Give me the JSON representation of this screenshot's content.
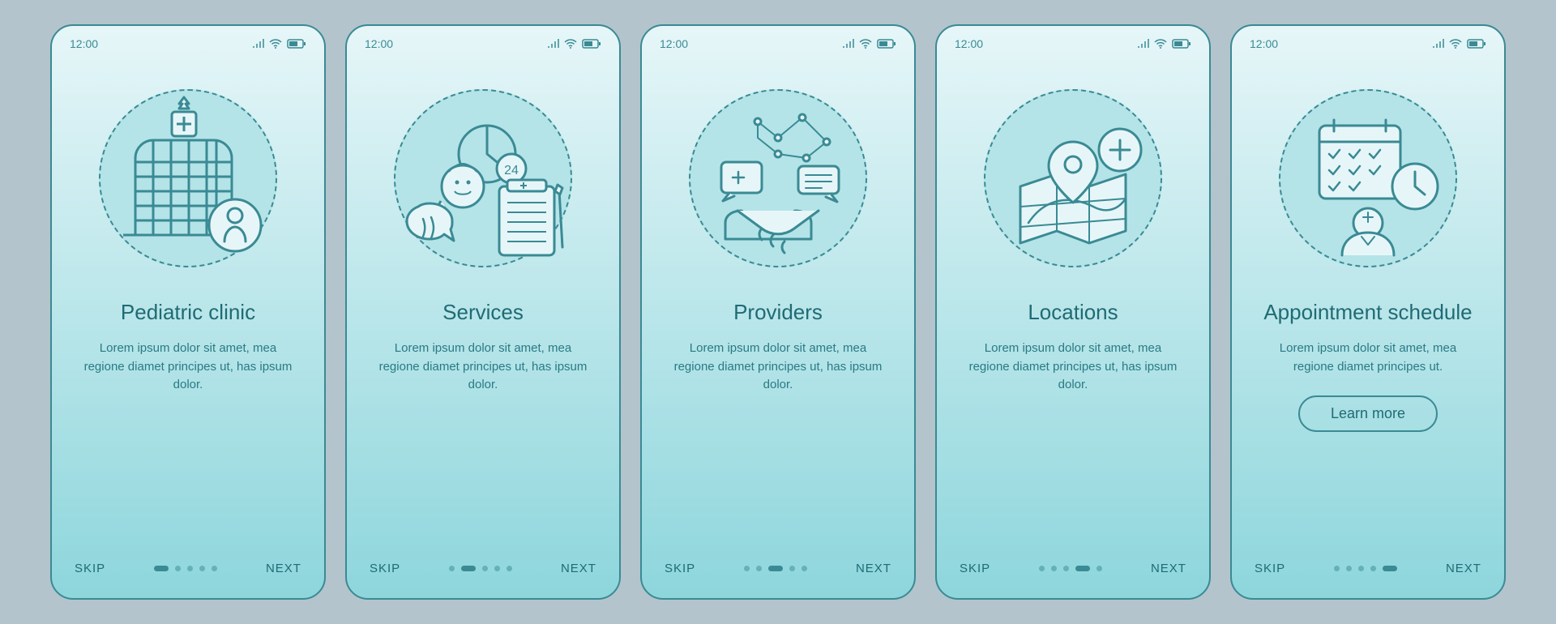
{
  "status": {
    "time": "12:00"
  },
  "nav": {
    "skip": "SKIP",
    "next": "NEXT"
  },
  "cta": {
    "learn_more": "Learn more"
  },
  "screens": [
    {
      "title": "Pediatric clinic",
      "desc": "Lorem ipsum dolor sit amet, mea regione diamet principes ut, has ipsum dolor."
    },
    {
      "title": "Services",
      "desc": "Lorem ipsum dolor sit amet, mea regione diamet principes ut, has ipsum dolor."
    },
    {
      "title": "Providers",
      "desc": "Lorem ipsum dolor sit amet, mea regione diamet principes ut, has ipsum dolor."
    },
    {
      "title": "Locations",
      "desc": "Lorem ipsum dolor sit amet, mea regione diamet principes ut, has ipsum dolor."
    },
    {
      "title": "Appointment schedule",
      "desc": "Lorem ipsum dolor sit amet, mea regione diamet principes ut."
    }
  ],
  "colors": {
    "stroke": "#3a8a94",
    "accent": "#b4e4e8"
  }
}
